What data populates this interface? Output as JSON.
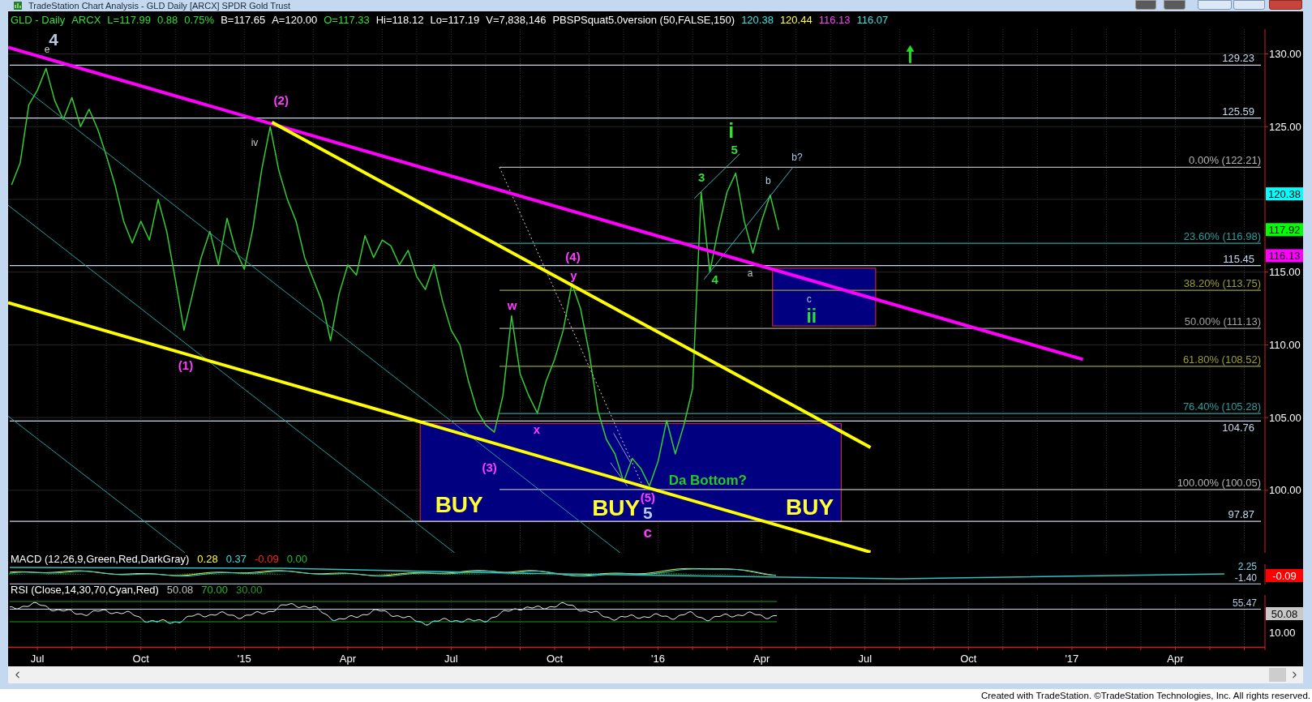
{
  "window": {
    "title": "TradeStation Chart Analysis - GLD Daily [ARCX] SPDR Gold Trust"
  },
  "legend": [
    {
      "text": "GLD - Daily",
      "color": "#33dd33"
    },
    {
      "text": "ARCX",
      "color": "#33dd33"
    },
    {
      "text": "L=117.99",
      "color": "#33dd33"
    },
    {
      "text": "0.88",
      "color": "#33dd33"
    },
    {
      "text": "0.75%",
      "color": "#33dd33"
    },
    {
      "text": "B=117.65",
      "color": "#ffffff"
    },
    {
      "text": "A=120.00",
      "color": "#ffffff"
    },
    {
      "text": "O=117.33",
      "color": "#33dd33"
    },
    {
      "text": "Hi=118.12",
      "color": "#ffffff"
    },
    {
      "text": "Lo=117.19",
      "color": "#ffffff"
    },
    {
      "text": "V=7,838,146",
      "color": "#ffffff"
    },
    {
      "text": "PBSPSquat5.0version (50,FALSE,150)",
      "color": "#ffffff"
    },
    {
      "text": "120.38",
      "color": "#40e0e0"
    },
    {
      "text": "120.44",
      "color": "#ffff40"
    },
    {
      "text": "116.13",
      "color": "#ff40ff"
    },
    {
      "text": "116.07",
      "color": "#40e0e0"
    }
  ],
  "price_chart": {
    "chart_data": {
      "type": "line",
      "categories": [
        null,
        null,
        null,
        "Jul",
        null,
        null,
        null,
        null,
        null,
        null,
        null,
        null,
        null,
        null,
        null,
        "Oct",
        null,
        null,
        null,
        null,
        null,
        null,
        null,
        null,
        null,
        null,
        null,
        "'15",
        null,
        null,
        null,
        null,
        null,
        null,
        null,
        null,
        null,
        null,
        null,
        "Apr",
        null,
        null,
        null,
        null,
        null,
        null,
        null,
        null,
        null,
        null,
        null,
        "Jul",
        null,
        null,
        null,
        null,
        null,
        null,
        null,
        null,
        null,
        null,
        null,
        "Oct",
        null,
        null,
        null,
        null,
        null,
        null,
        null,
        null,
        null,
        null,
        null,
        "'16",
        null,
        null,
        null,
        null,
        null,
        null,
        null,
        null,
        null,
        null,
        null,
        "Apr",
        null,
        null,
        null,
        null,
        null,
        null,
        null,
        null,
        null,
        null,
        null,
        "Jul",
        null,
        null,
        null,
        null,
        null,
        null,
        null,
        null,
        null,
        null,
        null,
        "Oct",
        null,
        null,
        null,
        null,
        null,
        null,
        null,
        null,
        null,
        null,
        null,
        "'17",
        null,
        null,
        null,
        null,
        null,
        null,
        null,
        null,
        null,
        null,
        null,
        "Apr",
        null,
        null,
        null,
        null,
        null,
        null,
        null,
        null,
        null,
        null
      ],
      "series": [
        {
          "color": "#33cc33",
          "values": [
            121.0,
            122.5,
            126.5,
            127.5,
            129.0,
            126.8,
            125.5,
            127.0,
            125.0,
            126.2,
            124.8,
            123.0,
            121.0,
            118.5,
            117.0,
            118.5,
            117.2,
            120.0,
            117.8,
            114.5,
            111.0,
            113.5,
            116.0,
            117.8,
            115.5,
            118.7,
            116.5,
            115.2,
            118.0,
            122.0,
            125.0,
            122.0,
            120.0,
            118.5,
            116.0,
            114.5,
            113.0,
            110.3,
            113.5,
            115.5,
            114.8,
            117.5,
            116.0,
            117.2,
            116.8,
            115.5,
            116.5,
            114.7,
            113.8,
            115.5,
            113.0,
            111.0,
            110.0,
            107.5,
            105.5,
            104.5,
            104.0,
            106.5,
            112.0,
            108.0,
            106.5,
            105.3,
            107.5,
            109.0,
            111.0,
            114.2,
            112.5,
            109.5,
            105.5,
            103.5,
            102.5,
            100.6,
            102.2,
            101.5,
            100.3,
            102.0,
            104.8,
            102.5,
            104.5,
            107.0,
            120.5,
            115.0,
            118.0,
            120.5,
            121.8,
            118.5,
            116.3,
            118.5,
            120.3,
            117.9,
            null,
            null,
            null,
            null,
            null,
            null,
            null,
            null,
            null,
            null,
            null,
            null,
            null,
            null,
            null,
            null,
            null,
            null,
            null,
            null,
            null,
            null,
            null,
            null,
            null,
            null,
            null,
            null,
            null,
            null,
            null,
            null,
            null,
            null,
            null,
            null,
            null,
            null,
            null,
            null,
            null,
            null,
            null,
            null,
            null,
            null,
            null,
            null,
            null,
            null,
            null,
            null,
            null,
            null,
            null,
            null
          ]
        }
      ],
      "ylim": [
        95.7,
        131.7
      ],
      "yticks": [
        {
          "value": 100,
          "label": "100.00"
        },
        {
          "value": 105,
          "label": "105.00"
        },
        {
          "value": 110,
          "label": "110.00"
        },
        {
          "value": 115,
          "label": "115.00"
        },
        {
          "value": 125,
          "label": "125.00"
        },
        {
          "value": 130,
          "label": "130.00"
        }
      ],
      "grid": true,
      "ref_lines": [
        {
          "axis": "y",
          "value": 129.23,
          "label": "129.23",
          "color": "#c8d8ec"
        },
        {
          "axis": "y",
          "value": 125.59,
          "label": "125.59",
          "color": "#c8d8ec"
        },
        {
          "axis": "y",
          "value": 122.21,
          "label": "0.00% (122.21)",
          "color": "#b4b4b4"
        },
        {
          "axis": "y",
          "value": 116.98,
          "label": "23.60% (116.98)",
          "color": "#2e9c9c"
        },
        {
          "axis": "y",
          "value": 115.45,
          "label": "115.45",
          "color": "#c8d8ec"
        },
        {
          "axis": "y",
          "value": 113.75,
          "label": "38.20% (113.75)",
          "color": "#9c9c34"
        },
        {
          "axis": "y",
          "value": 111.13,
          "label": "50.00% (111.13)",
          "color": "#a0a0a0"
        },
        {
          "axis": "y",
          "value": 108.52,
          "label": "61.80% (108.52)",
          "color": "#9c9c34"
        },
        {
          "axis": "y",
          "value": 105.28,
          "label": "76.40% (105.28)",
          "color": "#2e9c9c"
        },
        {
          "axis": "y",
          "value": 104.76,
          "label": "104.76",
          "color": "#c8d8ec"
        },
        {
          "axis": "y",
          "value": 100.05,
          "label": "100.00% (100.05)",
          "color": "#b4b4b4"
        },
        {
          "axis": "y",
          "value": 97.87,
          "label": "97.87",
          "color": "#c8d8ec"
        }
      ],
      "annotations": [
        "4",
        "e",
        "(2)",
        "iv",
        "(1)",
        "(3)",
        "w",
        "x",
        "(4)",
        "y",
        "(5)",
        "5",
        "c",
        "BUY",
        "BUY",
        "BUY",
        "Da Bottom?",
        "i",
        "5",
        "3",
        "4",
        "b?",
        "b",
        "a",
        "c",
        "ii"
      ]
    },
    "axis_tags": [
      {
        "text": "120.38",
        "color": "#00ffff"
      },
      {
        "text": "117.92",
        "color": "#00ff00"
      },
      {
        "text": "116.13",
        "color": "#ff00ff"
      }
    ]
  },
  "macd": {
    "label": "MACD (12,26,9,Green,Red,DarkGray)",
    "readings": [
      {
        "text": "0.28",
        "color": "#ffff33"
      },
      {
        "text": "0.37",
        "color": "#33dddd"
      },
      {
        "text": "-0.09",
        "color": "#ff2020"
      },
      {
        "text": "0.00",
        "color": "#22bb22"
      }
    ],
    "scale_labels": [
      "2.25",
      "-1.40"
    ],
    "tag": "-0.09"
  },
  "rsi": {
    "label": "RSI (Close,14,30,70,Cyan,Red)",
    "readings": [
      {
        "text": "50.08",
        "color": "#c0c0c0"
      },
      {
        "text": "70.00",
        "color": "#22bb22"
      },
      {
        "text": "30.00",
        "color": "#229922"
      }
    ],
    "level_label": "55.47",
    "tag": "50.08",
    "tick": "10.00"
  },
  "footer": "Created with TradeStation. ©TradeStation Technologies, Inc. All rights reserved."
}
